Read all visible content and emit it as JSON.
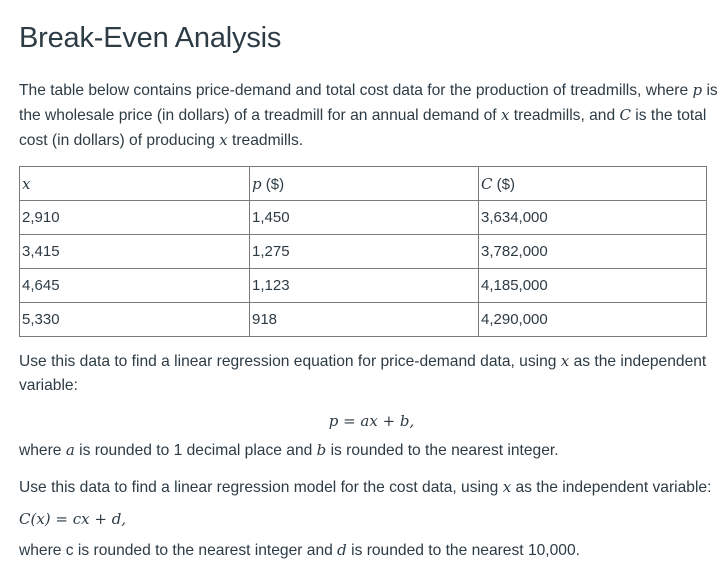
{
  "title": "Break-Even Analysis",
  "intro": {
    "part1": "The table below contains price-demand and total cost data for the production of treadmills, where ",
    "var_p": "p",
    "part2": " is the wholesale price (in dollars) of a treadmill for an annual demand of ",
    "var_x": "x",
    "part3": " treadmills, and ",
    "var_C": "C",
    "part4": " is the total cost (in dollars) of producing ",
    "var_x2": "x",
    "part5": " treadmills."
  },
  "table": {
    "headers": [
      {
        "var": "x",
        "unit": ""
      },
      {
        "var": "p",
        "unit": " ($)"
      },
      {
        "var": "C",
        "unit": " ($)"
      }
    ],
    "rows": [
      [
        "2,910",
        "1,450",
        "3,634,000"
      ],
      [
        "3,415",
        "1,275",
        "3,782,000"
      ],
      [
        "4,645",
        "1,123",
        "4,185,000"
      ],
      [
        "5,330",
        "918",
        "4,290,000"
      ]
    ]
  },
  "question1": {
    "text_a": "Use this data to find a linear regression equation for price-demand data, using ",
    "var": "x",
    "text_b": " as the independent variable:",
    "equation": "p = ax + b,",
    "cond_a": "where ",
    "var_a": "a",
    "cond_b": " is rounded to 1 decimal place and ",
    "var_b": "b",
    "cond_c": " is rounded to the nearest integer."
  },
  "question2": {
    "text_a": "Use this data to find a linear regression model for the cost data, using ",
    "var": "x",
    "text_b": " as the independent variable:",
    "equation": "C(x) = cx + d,",
    "cond_a": "where c is rounded to the nearest integer and ",
    "var_d": "d",
    "cond_b": " is rounded to the nearest 10,000."
  }
}
